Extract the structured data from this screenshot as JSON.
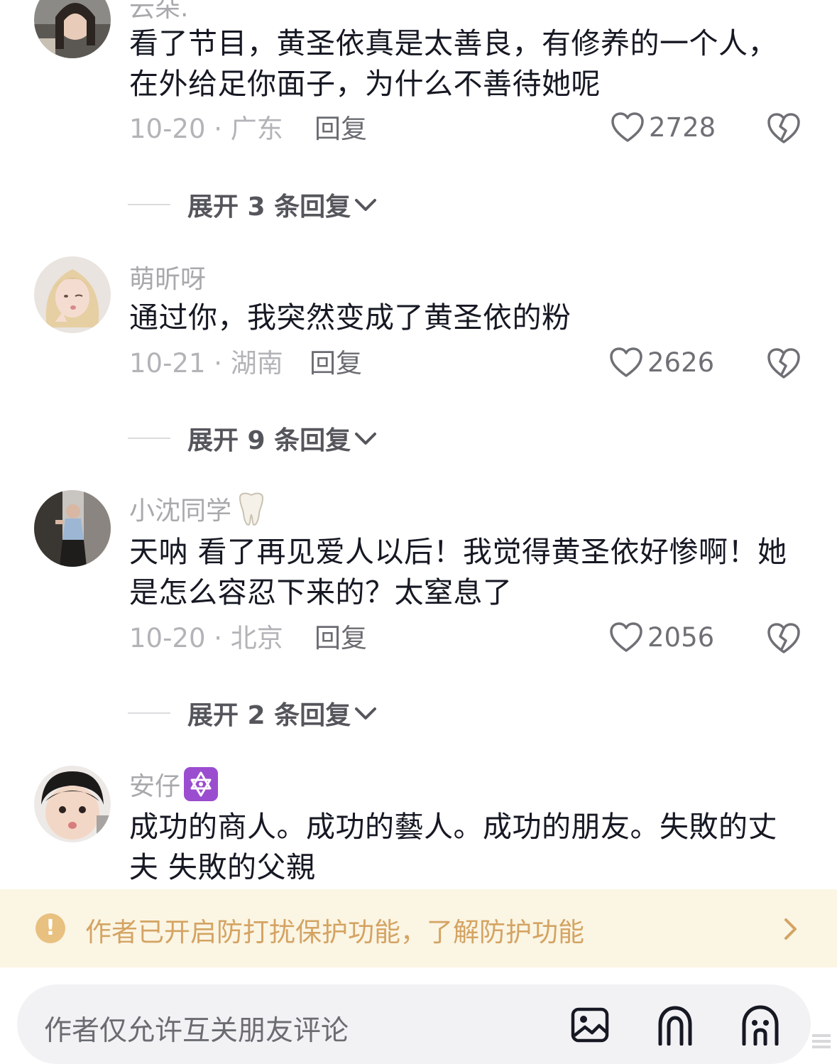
{
  "comments": [
    {
      "username": "云朵.",
      "text": "看了节目，黄圣依真是太善良，有修养的一个人，在外给足你面子，为什么不善待她呢",
      "date_location": "10-20 · 广东",
      "reply_label": "回复",
      "likes": "2728",
      "expand_label": "展开 3 条回复"
    },
    {
      "username": "萌昕呀",
      "text": "通过你，我突然变成了黄圣依的粉",
      "date_location": "10-21 · 湖南",
      "reply_label": "回复",
      "likes": "2626",
      "expand_label": "展开 9 条回复"
    },
    {
      "username": "小沈同学",
      "badge": "tooth-emoji",
      "text": "天呐 看了再见爱人以后！我觉得黄圣依好惨啊！她是怎么容忍下来的？太窒息了",
      "date_location": "10-20 · 北京",
      "reply_label": "回复",
      "likes": "2056",
      "expand_label": "展开 2 条回复"
    },
    {
      "username": "安仔",
      "badge": "star-of-david-emoji",
      "text": "成功的商人。成功的藝人。成功的朋友。失敗的丈夫 失敗的父親"
    }
  ],
  "notice": {
    "text": "作者已开启防打扰保护功能，了解防护功能",
    "icon": "warning-icon",
    "accent": "#d4a463",
    "background": "#fbf5e4"
  },
  "input": {
    "placeholder": "作者仅允许互关朋友评论",
    "icons": [
      "image-icon",
      "mention-icon",
      "emoji-icon"
    ]
  },
  "colors": {
    "text": "#161823",
    "secondary": "#a9a9ad",
    "input_bg": "#f2f2f4"
  }
}
